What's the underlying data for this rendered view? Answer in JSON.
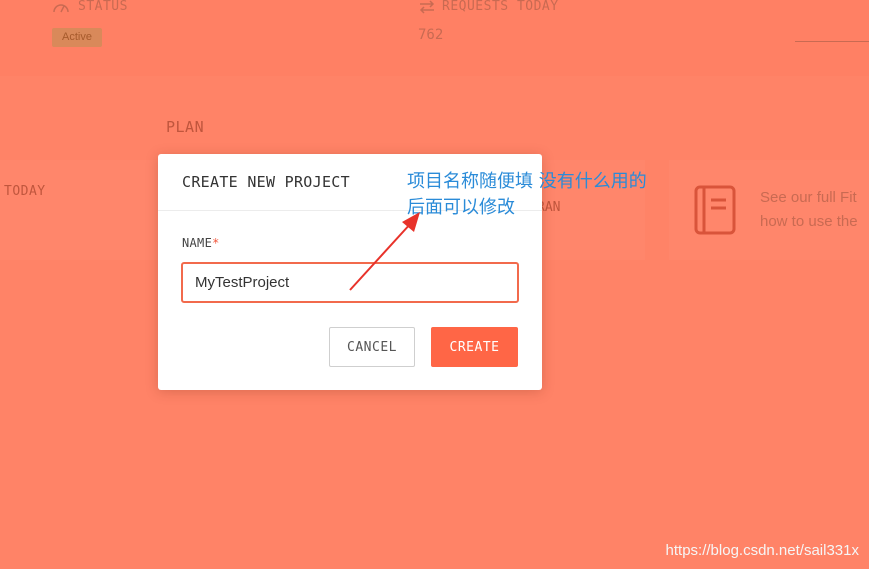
{
  "dashboard": {
    "status_label": "STATUS",
    "status_badge": "Active",
    "requests_label": "REQUESTS TODAY",
    "requests_value": "762",
    "plan_heading": "PLAN",
    "today_label": "TODAY",
    "plan_fragment": "RAN",
    "docs_line1": "See our full Fit",
    "docs_line2": "how to use the"
  },
  "modal": {
    "title": "CREATE NEW PROJECT",
    "name_label": "NAME",
    "required_mark": "*",
    "name_value": "MyTestProject",
    "cancel_label": "CANCEL",
    "create_label": "CREATE"
  },
  "annotation": {
    "line1": "项目名称随便填 没有什么用的",
    "line2": "后面可以修改",
    "color": "#2a8bd8",
    "arrow_color": "#e8322a"
  },
  "watermark": "https://blog.csdn.net/sail331x",
  "colors": {
    "overlay": "#ff8367",
    "accent": "#ff6646"
  }
}
